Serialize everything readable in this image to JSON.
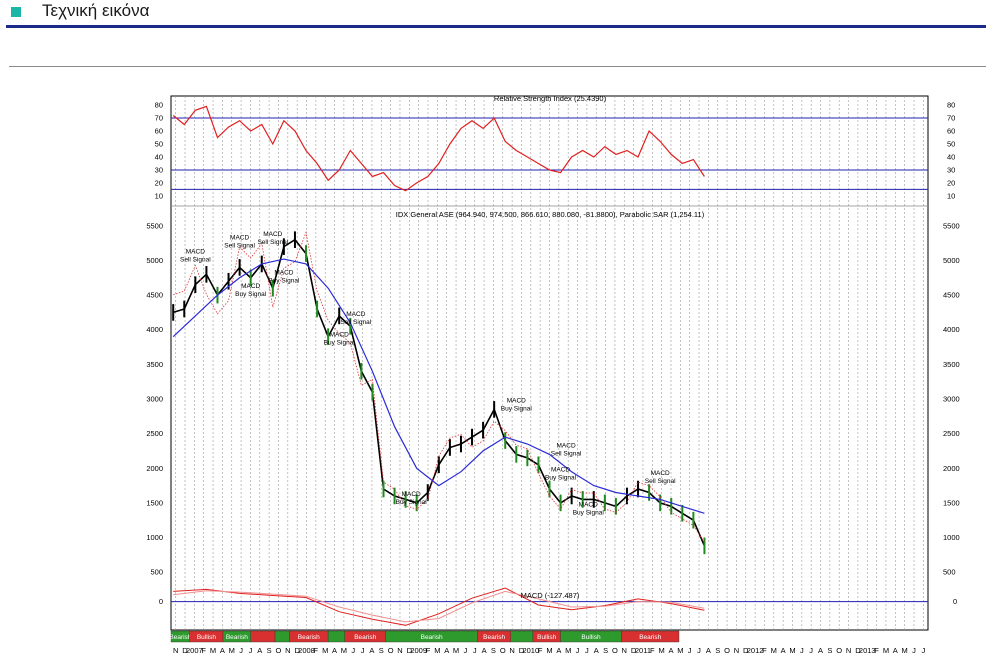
{
  "page": {
    "title": "Τεχνική εικόνα",
    "accent_color": "#19b5a6",
    "rule_color": "#1a2a86"
  },
  "chart_data": [
    {
      "type": "line",
      "title": "Relative Strength Index (25.4390)",
      "ylim": [
        10,
        80
      ],
      "yticks": [
        "80",
        "70",
        "60",
        "50",
        "40",
        "30",
        "20",
        "10"
      ],
      "reference_lines": [
        70,
        30,
        15
      ],
      "series": [
        {
          "color": "#e02020",
          "x": [
            2006.9,
            2007.0,
            2007.1,
            2007.2,
            2007.3,
            2007.4,
            2007.5,
            2007.6,
            2007.7,
            2007.8,
            2007.9,
            2008.0,
            2008.1,
            2008.2,
            2008.3,
            2008.4,
            2008.5,
            2008.6,
            2008.7,
            2008.8,
            2008.9,
            2009.0,
            2009.1,
            2009.2,
            2009.3,
            2009.4,
            2009.5,
            2009.6,
            2009.7,
            2009.8,
            2009.9,
            2010.0,
            2010.1,
            2010.2,
            2010.3,
            2010.4,
            2010.5,
            2010.6,
            2010.7,
            2010.8,
            2010.9,
            2011.0,
            2011.1,
            2011.2,
            2011.3,
            2011.4,
            2011.5,
            2011.6,
            2011.7
          ],
          "values": [
            72,
            65,
            76,
            79,
            55,
            63,
            68,
            60,
            65,
            50,
            68,
            60,
            45,
            35,
            22,
            30,
            45,
            35,
            25,
            28,
            18,
            14,
            20,
            25,
            35,
            50,
            62,
            68,
            62,
            70,
            52,
            45,
            40,
            35,
            30,
            28,
            40,
            45,
            40,
            48,
            42,
            45,
            40,
            60,
            52,
            42,
            35,
            38,
            25
          ]
        }
      ]
    },
    {
      "type": "line",
      "title": "IDX General ASE (964.940, 974.500, 866.610, 880.080, -81.8800), Parabolic SAR (1,254.11)",
      "ylim": [
        500,
        5500
      ],
      "yticks": [
        "5500",
        "5000",
        "4500",
        "4000",
        "3500",
        "3000",
        "2500",
        "2000",
        "1500",
        "1000",
        "500"
      ],
      "series": [
        {
          "color": "#000000",
          "x": [
            2006.9,
            2007.0,
            2007.1,
            2007.2,
            2007.3,
            2007.4,
            2007.5,
            2007.6,
            2007.7,
            2007.8,
            2007.9,
            2008.0,
            2008.1,
            2008.2,
            2008.3,
            2008.4,
            2008.5,
            2008.6,
            2008.7,
            2008.8,
            2008.9,
            2009.0,
            2009.1,
            2009.2,
            2009.3,
            2009.4,
            2009.5,
            2009.6,
            2009.7,
            2009.8,
            2009.9,
            2010.0,
            2010.1,
            2010.2,
            2010.3,
            2010.4,
            2010.5,
            2010.6,
            2010.7,
            2010.8,
            2010.9,
            2011.0,
            2011.1,
            2011.2,
            2011.3,
            2011.4,
            2011.5,
            2011.6,
            2011.7
          ],
          "values": [
            4250,
            4300,
            4650,
            4800,
            4500,
            4700,
            4900,
            4750,
            4950,
            4600,
            5200,
            5300,
            5100,
            4300,
            3900,
            4200,
            4050,
            3400,
            3100,
            1700,
            1600,
            1550,
            1500,
            1650,
            2050,
            2300,
            2350,
            2450,
            2550,
            2850,
            2400,
            2200,
            2150,
            2050,
            1700,
            1500,
            1600,
            1550,
            1550,
            1500,
            1450,
            1600,
            1700,
            1650,
            1500,
            1450,
            1350,
            1250,
            880
          ]
        },
        {
          "name": "",
          "color": "#2b2bd6",
          "x": [
            2006.9,
            2007.1,
            2007.3,
            2007.5,
            2007.7,
            2007.9,
            2008.1,
            2008.3,
            2008.5,
            2008.7,
            2008.9,
            2009.1,
            2009.3,
            2009.5,
            2009.7,
            2009.9,
            2010.1,
            2010.3,
            2010.5,
            2010.7,
            2010.9,
            2011.1,
            2011.3,
            2011.5,
            2011.7
          ],
          "values": [
            3900,
            4200,
            4500,
            4750,
            4950,
            5020,
            4950,
            4600,
            4100,
            3400,
            2600,
            2000,
            1750,
            1950,
            2250,
            2450,
            2350,
            2200,
            1950,
            1750,
            1650,
            1600,
            1550,
            1450,
            1350
          ]
        }
      ],
      "annotations": [
        {
          "text": [
            "MACD",
            "Sell Signal"
          ],
          "x": 2007.1,
          "y": 5100
        },
        {
          "text": [
            "MACD",
            "Sell Signal"
          ],
          "x": 2007.5,
          "y": 5300
        },
        {
          "text": [
            "MACD",
            "Sell Signal"
          ],
          "x": 2007.8,
          "y": 5350
        },
        {
          "text": [
            "MACD",
            "Buy Signal"
          ],
          "x": 2007.6,
          "y": 4600
        },
        {
          "text": [
            "MACD",
            "Buy Signal"
          ],
          "x": 2007.9,
          "y": 4800
        },
        {
          "text": [
            "MACD",
            "Sell Signal"
          ],
          "x": 2008.55,
          "y": 4200
        },
        {
          "text": [
            "MACD",
            "Buy Signal"
          ],
          "x": 2008.4,
          "y": 3900
        },
        {
          "text": [
            "MACD",
            "Buy Signal"
          ],
          "x": 2009.05,
          "y": 1600
        },
        {
          "text": [
            "MACD",
            "Buy Signal"
          ],
          "x": 2010.0,
          "y": 2950
        },
        {
          "text": [
            "MACD",
            "Sell Signal"
          ],
          "x": 2010.45,
          "y": 2300
        },
        {
          "text": [
            "MACD",
            "Buy Signal"
          ],
          "x": 2010.4,
          "y": 1950
        },
        {
          "text": [
            "MACD",
            "Buy Signal"
          ],
          "x": 2010.65,
          "y": 1450
        },
        {
          "text": [
            "MACD",
            "Sell Signal"
          ],
          "x": 2011.3,
          "y": 1900
        }
      ]
    },
    {
      "type": "line",
      "title": "MACD (-127.487)",
      "ylim": [
        -400,
        200
      ],
      "yticks": [
        "0"
      ],
      "reference_lines": [
        0
      ],
      "series": [
        {
          "color": "#e02020",
          "x": [
            2006.9,
            2007.2,
            2007.5,
            2007.8,
            2008.1,
            2008.4,
            2008.7,
            2009.0,
            2009.3,
            2009.6,
            2009.9,
            2010.2,
            2010.5,
            2010.8,
            2011.1,
            2011.4,
            2011.7
          ],
          "values": [
            150,
            180,
            120,
            90,
            60,
            -150,
            -260,
            -350,
            -180,
            50,
            200,
            -50,
            -120,
            -60,
            40,
            -30,
            -127
          ]
        },
        {
          "color": "#f09090",
          "x": [
            2006.9,
            2007.2,
            2007.5,
            2007.8,
            2008.1,
            2008.4,
            2008.7,
            2009.0,
            2009.3,
            2009.6,
            2009.9,
            2010.2,
            2010.5,
            2010.8,
            2011.1,
            2011.4,
            2011.7
          ],
          "values": [
            100,
            160,
            140,
            110,
            80,
            -80,
            -200,
            -300,
            -250,
            -20,
            150,
            40,
            -80,
            -70,
            0,
            -10,
            -100
          ]
        }
      ]
    }
  ],
  "sentiment_bands": [
    {
      "label": "Bearish",
      "from": 2006.88,
      "to": 2007.05,
      "color": "#2e9a2e"
    },
    {
      "label": "Bullish",
      "from": 2007.05,
      "to": 2007.35,
      "color": "#d83030"
    },
    {
      "label": "Bearish",
      "from": 2007.35,
      "to": 2007.6,
      "color": "#2e9a2e"
    },
    {
      "label": "",
      "from": 2007.6,
      "to": 2007.82,
      "color": "#d83030"
    },
    {
      "label": "",
      "from": 2007.82,
      "to": 2007.95,
      "color": "#2e9a2e"
    },
    {
      "label": "Bearish",
      "from": 2007.95,
      "to": 2008.3,
      "color": "#d83030"
    },
    {
      "label": "",
      "from": 2008.3,
      "to": 2008.45,
      "color": "#2e9a2e"
    },
    {
      "label": "Bearish",
      "from": 2008.45,
      "to": 2008.82,
      "color": "#d83030"
    },
    {
      "label": "Bearish",
      "from": 2008.82,
      "to": 2009.65,
      "color": "#2e9a2e"
    },
    {
      "label": "Bearish",
      "from": 2009.65,
      "to": 2009.95,
      "color": "#d83030"
    },
    {
      "label": "",
      "from": 2009.95,
      "to": 2010.15,
      "color": "#2e9a2e"
    },
    {
      "label": "Bullish",
      "from": 2010.15,
      "to": 2010.4,
      "color": "#d83030"
    },
    {
      "label": "Bullish",
      "from": 2010.4,
      "to": 2010.95,
      "color": "#2e9a2e"
    },
    {
      "label": "Bearish",
      "from": 2010.95,
      "to": 2011.47,
      "color": "#d83030"
    }
  ],
  "time_axis": {
    "start": 2006.88,
    "end": 2013.72,
    "labels": [
      "N",
      "D",
      "2007",
      "F",
      "M",
      "A",
      "M",
      "J",
      "J",
      "A",
      "S",
      "O",
      "N",
      "D",
      "2008",
      "F",
      "M",
      "A",
      "M",
      "J",
      "J",
      "A",
      "S",
      "O",
      "N",
      "D",
      "2009",
      "F",
      "M",
      "A",
      "M",
      "J",
      "J",
      "A",
      "S",
      "O",
      "N",
      "D",
      "2010",
      "F",
      "M",
      "A",
      "M",
      "J",
      "J",
      "A",
      "S",
      "O",
      "N",
      "D",
      "2011",
      "F",
      "M",
      "A",
      "M",
      "J",
      "J",
      "A",
      "S",
      "O",
      "N",
      "D",
      "2012",
      "F",
      "M",
      "A",
      "M",
      "J",
      "J",
      "A",
      "S",
      "O",
      "N",
      "D",
      "2013",
      "F",
      "M",
      "A",
      "M",
      "J",
      "J"
    ]
  }
}
